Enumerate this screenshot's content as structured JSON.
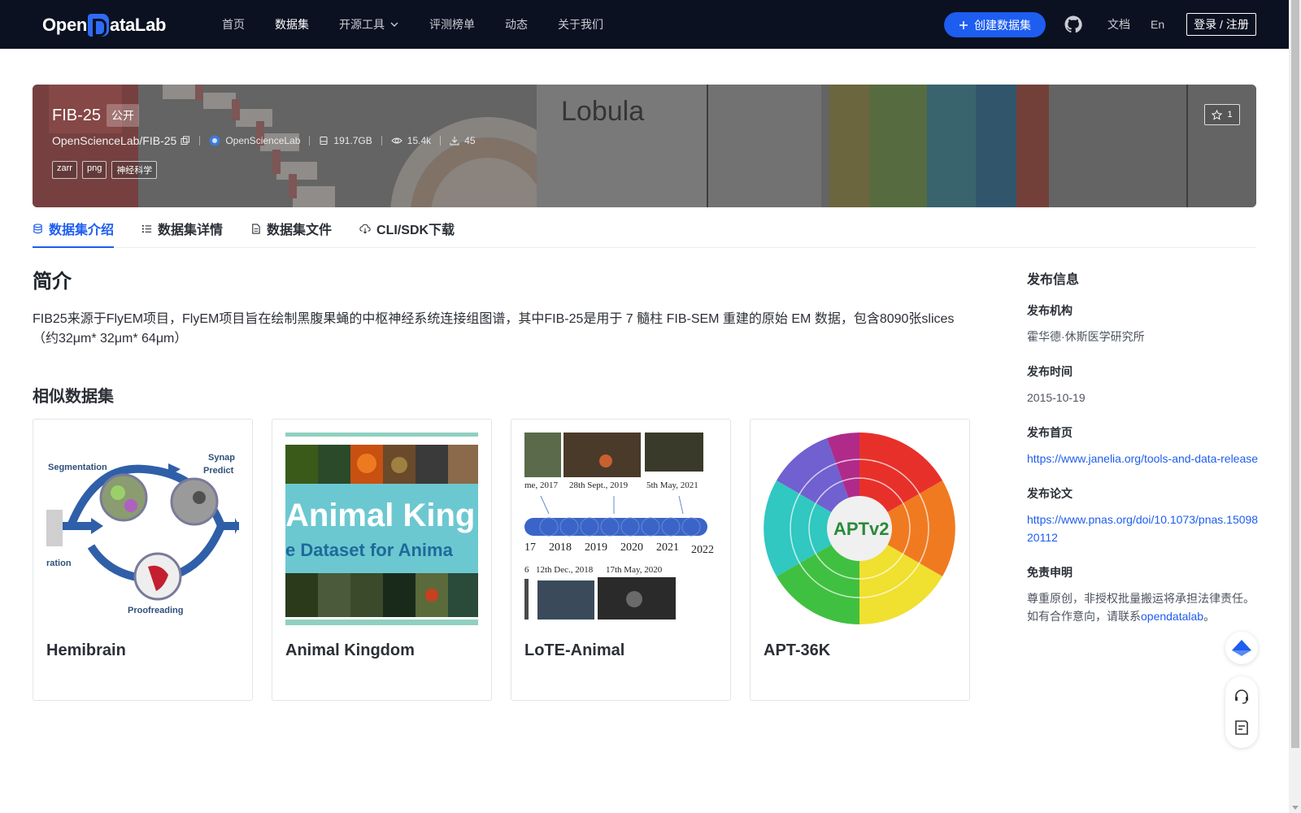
{
  "nav": {
    "logo_text_left": "Open",
    "logo_text_right": "ataLab",
    "items": [
      {
        "label": "首页"
      },
      {
        "label": "数据集"
      },
      {
        "label": "开源工具"
      },
      {
        "label": "评测榜单"
      },
      {
        "label": "动态"
      },
      {
        "label": "关于我们"
      }
    ],
    "create_label": "创建数据集",
    "docs_label": "文档",
    "lang_label": "En",
    "login_label": "登录 / 注册"
  },
  "hero": {
    "title": "FIB-25",
    "badge": "公开",
    "repo": "OpenScienceLab/FIB-25",
    "org": "OpenScienceLab",
    "size": "191.7GB",
    "views": "15.4k",
    "downloads": "45",
    "tags": [
      "zarr",
      "png",
      "神经科学"
    ],
    "stars": "1",
    "banner_text": "Lobula"
  },
  "tabs": [
    {
      "label": "数据集介绍",
      "active": true
    },
    {
      "label": "数据集详情",
      "active": false
    },
    {
      "label": "数据集文件",
      "active": false
    },
    {
      "label": "CLI/SDK下载",
      "active": false
    }
  ],
  "intro": {
    "title": "简介",
    "text": "FIB25来源于FlyEM项目，FlyEM项目旨在绘制黑腹果蝇的中枢神经系统连接组图谱，其中FIB-25是用于 7 髓柱 FIB-SEM 重建的原始 EM 数据，包含8090张slices（约32μm* 32μm* 64μm）"
  },
  "similar": {
    "title": "相似数据集",
    "cards": [
      {
        "title": "Hemibrain",
        "img_labels": [
          "Segmentation",
          "Synap",
          "Predict",
          "ration",
          "Proofreading"
        ]
      },
      {
        "title": "Animal Kingdom",
        "img_labels": [
          "Animal King",
          "e Dataset for Anima"
        ]
      },
      {
        "title": "LoTE-Animal",
        "img_labels": [
          "me, 2017",
          "28th Sept., 2019",
          "5th May, 2021",
          "17",
          "2018",
          "2019",
          "2020",
          "2021",
          "2022",
          "6",
          "12th Dec., 2018",
          "17th May, 2020"
        ]
      },
      {
        "title": "APT-36K",
        "img_labels": [
          "APTv2"
        ]
      }
    ]
  },
  "sidebar": {
    "title": "发布信息",
    "org_label": "发布机构",
    "org_value": "霍华德·休斯医学研究所",
    "date_label": "发布时间",
    "date_value": "2015-10-19",
    "homepage_label": "发布首页",
    "homepage_value": "https://www.janelia.org/tools-and-data-release",
    "paper_label": "发布论文",
    "paper_value": "https://www.pnas.org/doi/10.1073/pnas.1509820112",
    "disclaimer_label": "免责申明",
    "disclaimer_text": "尊重原创，非授权批量搬运将承担法律责任。如有合作意向，请联系",
    "disclaimer_link": "opendatalab",
    "disclaimer_end": "。"
  },
  "colors": {
    "accent": "#1d5df0",
    "nav_bg": "#0b1121"
  }
}
